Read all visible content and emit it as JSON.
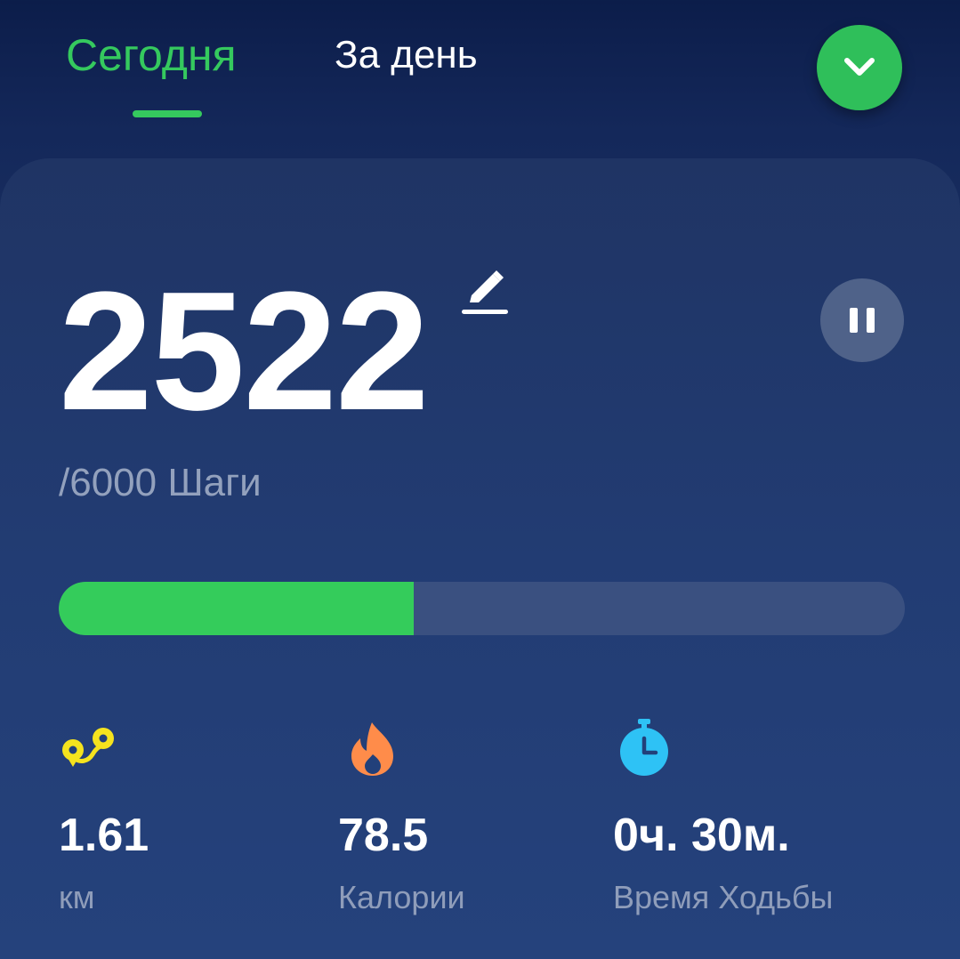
{
  "header": {
    "tabs": [
      {
        "label": "Сегодня",
        "active": true
      },
      {
        "label": "За день",
        "active": false
      }
    ],
    "dropdown_icon": "chevron-down-icon"
  },
  "steps": {
    "count": "2522",
    "goal_text": "/6000 Шаги",
    "progress_percent": 42
  },
  "controls": {
    "edit_icon": "pencil-icon",
    "pause_icon": "pause-icon"
  },
  "stats": {
    "distance": {
      "value": "1.61",
      "label": "км",
      "icon": "route-pin-icon"
    },
    "calories": {
      "value": "78.5",
      "label": "Калории",
      "icon": "flame-icon"
    },
    "time": {
      "value": "0ч. 30м.",
      "label": "Время Ходьбы",
      "icon": "stopwatch-icon"
    }
  },
  "colors": {
    "accent_green": "#35c95e",
    "distance_icon": "#f5e31e",
    "calories_icon": "#ff8c4a",
    "time_icon": "#2ec2f5"
  }
}
